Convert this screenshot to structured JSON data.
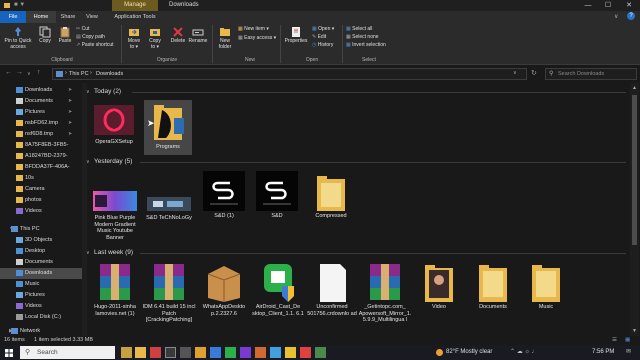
{
  "titlebar": {
    "manage": "Manage",
    "title": "Downloads",
    "minimize": "—",
    "maximize": "☐",
    "close": "✕"
  },
  "tabs": {
    "file": "File",
    "home": "Home",
    "share": "Share",
    "view": "View",
    "app_tools": "Application Tools"
  },
  "ribbon": {
    "pin": [
      "Pin to Quick",
      "access"
    ],
    "copy": "Copy",
    "paste": "Paste",
    "cut": "Cut",
    "copy_path": "Copy path",
    "paste_shortcut": "Paste shortcut",
    "clipboard": "Clipboard",
    "move_to": [
      "Move",
      "to ▾"
    ],
    "copy_to": [
      "Copy",
      "to ▾"
    ],
    "delete": "Delete",
    "rename": "Rename",
    "organize": "Organize",
    "new_folder": [
      "New",
      "folder"
    ],
    "new_item": "New item ▾",
    "easy_access": "Easy access ▾",
    "new": "New",
    "properties": "Properties",
    "open": "Open ▾",
    "edit": "Edit",
    "history": "History",
    "open_group": "Open",
    "select_all": "Select all",
    "select_none": "Select none",
    "invert_selection": "Invert selection",
    "select": "Select"
  },
  "address": {
    "path_this_pc": "This PC",
    "sep": "›",
    "path_downloads": "Downloads",
    "search_placeholder": "Search Downloads"
  },
  "sidebar": {
    "items": [
      {
        "label": "Downloads"
      },
      {
        "label": "Documents"
      },
      {
        "label": "Pictures"
      },
      {
        "label": "nsbFD62.tmp"
      },
      {
        "label": "nsf6D8.tmp"
      },
      {
        "label": "8A75F8EB-3FB5-"
      },
      {
        "label": "A18247BD-2379-"
      },
      {
        "label": "BFDDA37F-406A-"
      },
      {
        "label": "10s"
      },
      {
        "label": "Camera"
      },
      {
        "label": "photos"
      },
      {
        "label": "Videos"
      },
      {
        "label": "This PC"
      },
      {
        "label": "3D Objects"
      },
      {
        "label": "Desktop"
      },
      {
        "label": "Documents"
      },
      {
        "label": "Downloads"
      },
      {
        "label": "Music"
      },
      {
        "label": "Pictures"
      },
      {
        "label": "Videos"
      },
      {
        "label": "Local Disk (C:)"
      },
      {
        "label": "Network"
      }
    ]
  },
  "sections": {
    "today": "Today (2)",
    "yesterday": "Yesterday (5)",
    "last_week": "Last week (9)"
  },
  "files": {
    "today": [
      {
        "name": "OperaGXSetup"
      },
      {
        "name": "Programs"
      }
    ],
    "yesterday": [
      {
        "name": "Pink Blue Purple Modern Gradient Music Youtube Banner"
      },
      {
        "name": "S&D TeChNoLoGy"
      },
      {
        "name": "S&D (1)"
      },
      {
        "name": "S&D"
      },
      {
        "name": "Compressed"
      }
    ],
    "last_week": [
      {
        "name": "Hugo-2011-sinha lamovies.net (1)"
      },
      {
        "name": "IDM 6.41 build 15 incl Patch [CrackingPatching]"
      },
      {
        "name": "WhatsAppDeskto p.2.2327.6"
      },
      {
        "name": "AirDroid_Cast_De sktop_Client_1.1. 6.1"
      },
      {
        "name": "Unconfirmed 501756.crdownlo ad"
      },
      {
        "name": "_Getintopc.com_ Apowersoft_Mirror_1. 5.9.9_Multilingua l"
      },
      {
        "name": "Video"
      },
      {
        "name": "Documents"
      },
      {
        "name": "Music"
      }
    ]
  },
  "status": {
    "items": "16 items",
    "selected": "1 item selected  3.33 MB"
  },
  "taskbar": {
    "search": "Search",
    "weather": "82°F  Mostly clear",
    "time": "7:56 PM"
  },
  "colors": {
    "accent": "#1565c0",
    "folder": "#e8b84a",
    "manage": "#6d5a1f"
  }
}
